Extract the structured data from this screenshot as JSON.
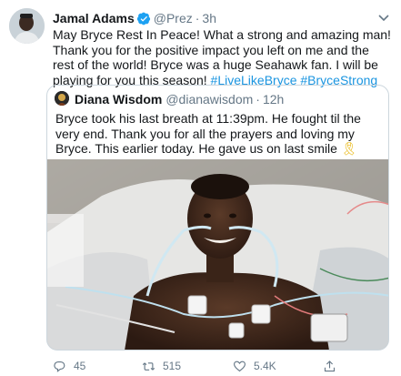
{
  "tweet": {
    "author_name": "Jamal Adams",
    "handle": "@Prez",
    "separator": "·",
    "time": "3h",
    "text_main": "May Bryce Rest In Peace! What a strong and amazing man! Thank you for the positive impact you left on me and the rest of the world! Bryce was a huge Seahawk fan. I will be playing for you this season!",
    "hashtag1": "#LiveLikeBryce",
    "hashtag2": "#BryceStrong"
  },
  "quote": {
    "author_name": "Diana Wisdom",
    "handle": "@dianawisdom",
    "separator": "·",
    "time": "12h",
    "text": "Bryce took his last breath at 11:39pm. He fought til the very end. Thank you for all the prayers and loving my Bryce. This earlier today. He gave us on last smile",
    "ribbon_emoji": "🎗"
  },
  "actions": {
    "reply_count": "45",
    "retweet_count": "515",
    "like_count": "5.4K",
    "reply_icon": "reply-icon",
    "retweet_icon": "retweet-icon",
    "like_icon": "heart-icon",
    "share_icon": "share-icon"
  },
  "colors": {
    "link": "#1b95e0",
    "secondary_text": "#657786",
    "border": "#ccd6dd",
    "verified": "#1da1f2"
  }
}
